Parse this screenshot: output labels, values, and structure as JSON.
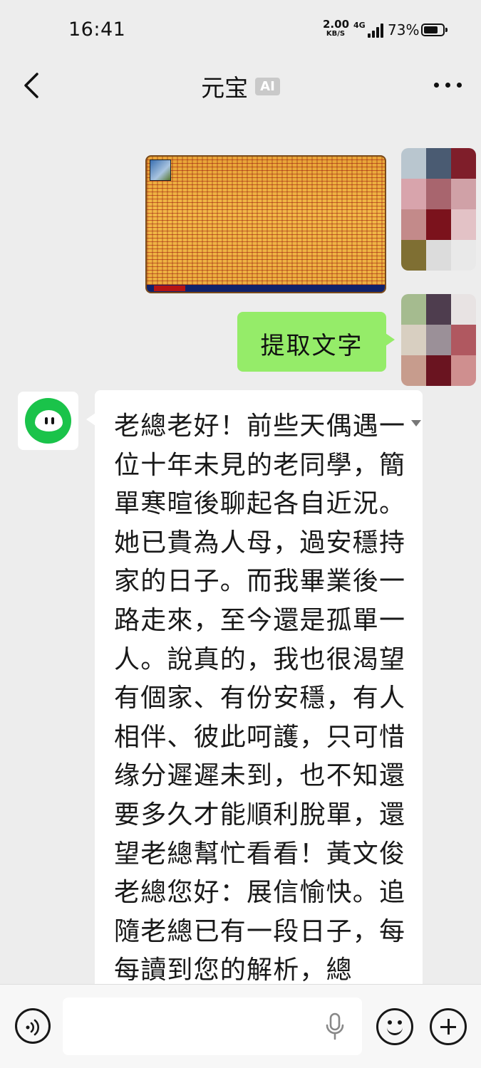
{
  "status_bar": {
    "time": "16:41",
    "net_speed_value": "2.00",
    "net_speed_unit": "KB/S",
    "network_type": "4G",
    "battery_percent": "73%"
  },
  "header": {
    "title": "元宝",
    "badge": "AI",
    "back_icon": "back-chevron-icon",
    "more_icon": "more-dots-icon"
  },
  "messages": {
    "user_image": {
      "type": "image",
      "description_icon": "image-thumbnail"
    },
    "user_text": "提取文字",
    "bot_text": "老總老好！前些天偶遇一位十年未見的老同學，簡單寒暄後聊起各自近況。她已貴為人母，過安穩持家的日子。而我畢業後一路走來，至今還是孤單一人。說真的，我也很渴望有個家、有份安穩，有人相伴、彼此呵護，只可惜缘分遲遲未到，也不知還要多久才能順利脫單，還望老總幫忙看看！黃文俊老總您好：展信愉快。追隨老總已有一段日子，每每讀到您的解析，總"
  },
  "input_bar": {
    "placeholder": "",
    "voice_icon": "voice-mode-icon",
    "mic_icon": "microphone-icon",
    "emoji_icon": "emoji-icon",
    "plus_icon": "plus-icon"
  },
  "colors": {
    "user_bubble": "#95ec69",
    "brand_green": "#1ac34a",
    "background": "#ededed"
  }
}
